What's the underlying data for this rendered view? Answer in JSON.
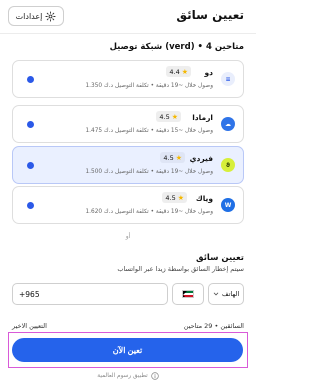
{
  "header": {
    "title": "تعيين سائق",
    "settings_label": "إعدادات"
  },
  "section": {
    "title": "شبكة توصيل (verd) • 4 متاحين"
  },
  "providers": [
    {
      "name": "دو",
      "rating": "4.4",
      "meta": "وصول خلال ~19 دقيقة • تكلفة التوصيل د.ك 1.350",
      "logo_color": "#e9eefc",
      "logo_fg": "#2b59e8",
      "logo_glyph": "≡",
      "selected": false
    },
    {
      "name": "ارمادا",
      "rating": "4.5",
      "meta": "وصول خلال ~15 دقيقة • تكلفة التوصيل د.ك 1.475",
      "logo_color": "#2f74e8",
      "logo_fg": "#ffffff",
      "logo_glyph": "☁",
      "selected": false
    },
    {
      "name": "فيردي",
      "rating": "4.5",
      "meta": "وصول خلال ~19 دقيقة • تكلفة التوصيل د.ك 1.500",
      "logo_color": "#d7ef3a",
      "logo_fg": "#2a3a00",
      "logo_glyph": "ϑ",
      "selected": true
    },
    {
      "name": "وياك",
      "rating": "4.5",
      "meta": "وصول خلال ~19 دقيقة • تكلفة التوصيل د.ك 1.620",
      "logo_color": "#1f6fe5",
      "logo_fg": "#ffffff",
      "logo_glyph": "W",
      "selected": false
    }
  ],
  "divider": {
    "label": "أو"
  },
  "assign": {
    "title": "تعيين سائق",
    "subtitle": "سيتم إخطار السائق بواسطة زيدا عبر الواتساب",
    "phone_value": "+965",
    "type_label": "الهاتف",
    "drivers_count": "السائقين • 29 متاحين",
    "last_assign": "التعيين الاخير",
    "button_label": "تعين الآن",
    "fees_link": "تطبيق رسوم العالمية"
  },
  "colors": {
    "accent": "#2563eb",
    "star": "#f5b800",
    "selected_bg": "#eaf0ff"
  }
}
